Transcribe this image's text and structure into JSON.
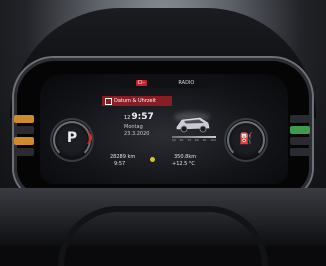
{
  "display": {
    "topbar": {
      "red_tag": "Cl–",
      "label": "RADIO"
    },
    "menu": {
      "title": "Datum & Uhrzeit"
    },
    "clock": {
      "prefix": "12",
      "time": "9:57"
    },
    "day": "Montag",
    "date": "23.3.2020",
    "gear": "P",
    "odometer": "28289 km",
    "small_clock": "9:57",
    "trip": "350.8km",
    "outside_temp": "+12.5 °C",
    "scale_ticks": [
      "50",
      "60",
      "70",
      "80",
      "90",
      "100"
    ]
  },
  "colors": {
    "menu_red": "#8a1c24",
    "warning_red": "#d62b2b",
    "indicator_amber": "#d08a2a",
    "indicator_green": "#3c9a4a"
  }
}
